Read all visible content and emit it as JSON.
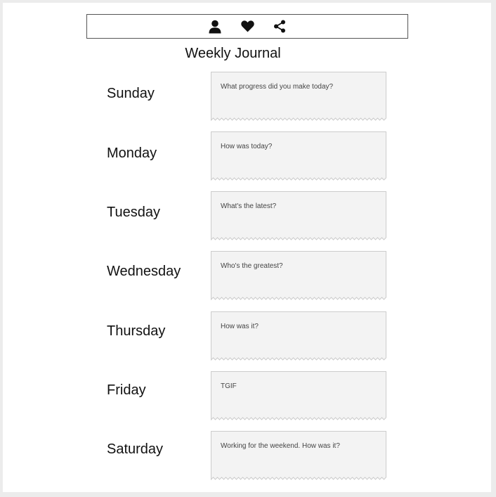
{
  "toolbar": {
    "icons": [
      "user-icon",
      "heart-icon",
      "share-icon"
    ]
  },
  "title": "Weekly Journal",
  "days": [
    {
      "day": "Sunday",
      "prompt": "What progress did you make today?"
    },
    {
      "day": "Monday",
      "prompt": "How was today?"
    },
    {
      "day": "Tuesday",
      "prompt": "What's the latest?"
    },
    {
      "day": "Wednesday",
      "prompt": "Who's the greatest?"
    },
    {
      "day": "Thursday",
      "prompt": "How was it?"
    },
    {
      "day": "Friday",
      "prompt": "TGIF"
    },
    {
      "day": "Saturday",
      "prompt": "Working for the weekend. How was it?"
    }
  ],
  "colors": {
    "note_fill": "#f3f3f3",
    "note_border": "#cccccc",
    "text": "#111111"
  }
}
